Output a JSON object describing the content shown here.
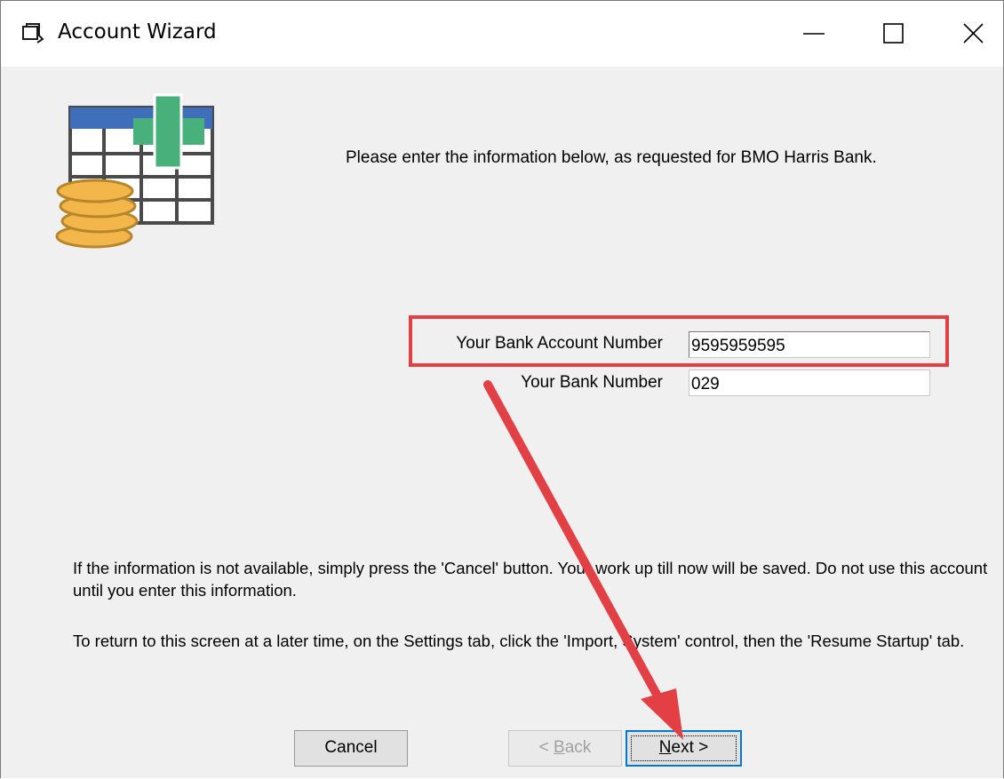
{
  "window": {
    "title": "Account Wizard"
  },
  "titlebar": {
    "minimize_icon": "minimize-icon",
    "maximize_icon": "maximize-icon",
    "close_icon": "close-icon"
  },
  "wizard": {
    "icon": "account-table-coins-plus-icon",
    "intro": "Please enter the information below, as requested for BMO Harris Bank.",
    "fields": {
      "account_label": "Your Bank Account Number",
      "account_value": "9595959595",
      "bank_label": "Your Bank Number",
      "bank_value": "029"
    },
    "info_text_1": "If the information is not available, simply press the 'Cancel' button.  Your work up till now will be saved.  Do not use this account until you enter this information.",
    "info_text_2": "To return to this screen at a later time, on the Settings tab, click the 'Import, System'  control, then the 'Resume Startup' tab."
  },
  "buttons": {
    "cancel": "Cancel",
    "back_prefix": "< ",
    "back_mnemonic": "B",
    "back_rest": "ack",
    "next_mnemonic": "N",
    "next_rest": "ext >"
  },
  "annotation": {
    "highlight_color": "#e34046",
    "arrow_color": "#e34046"
  }
}
